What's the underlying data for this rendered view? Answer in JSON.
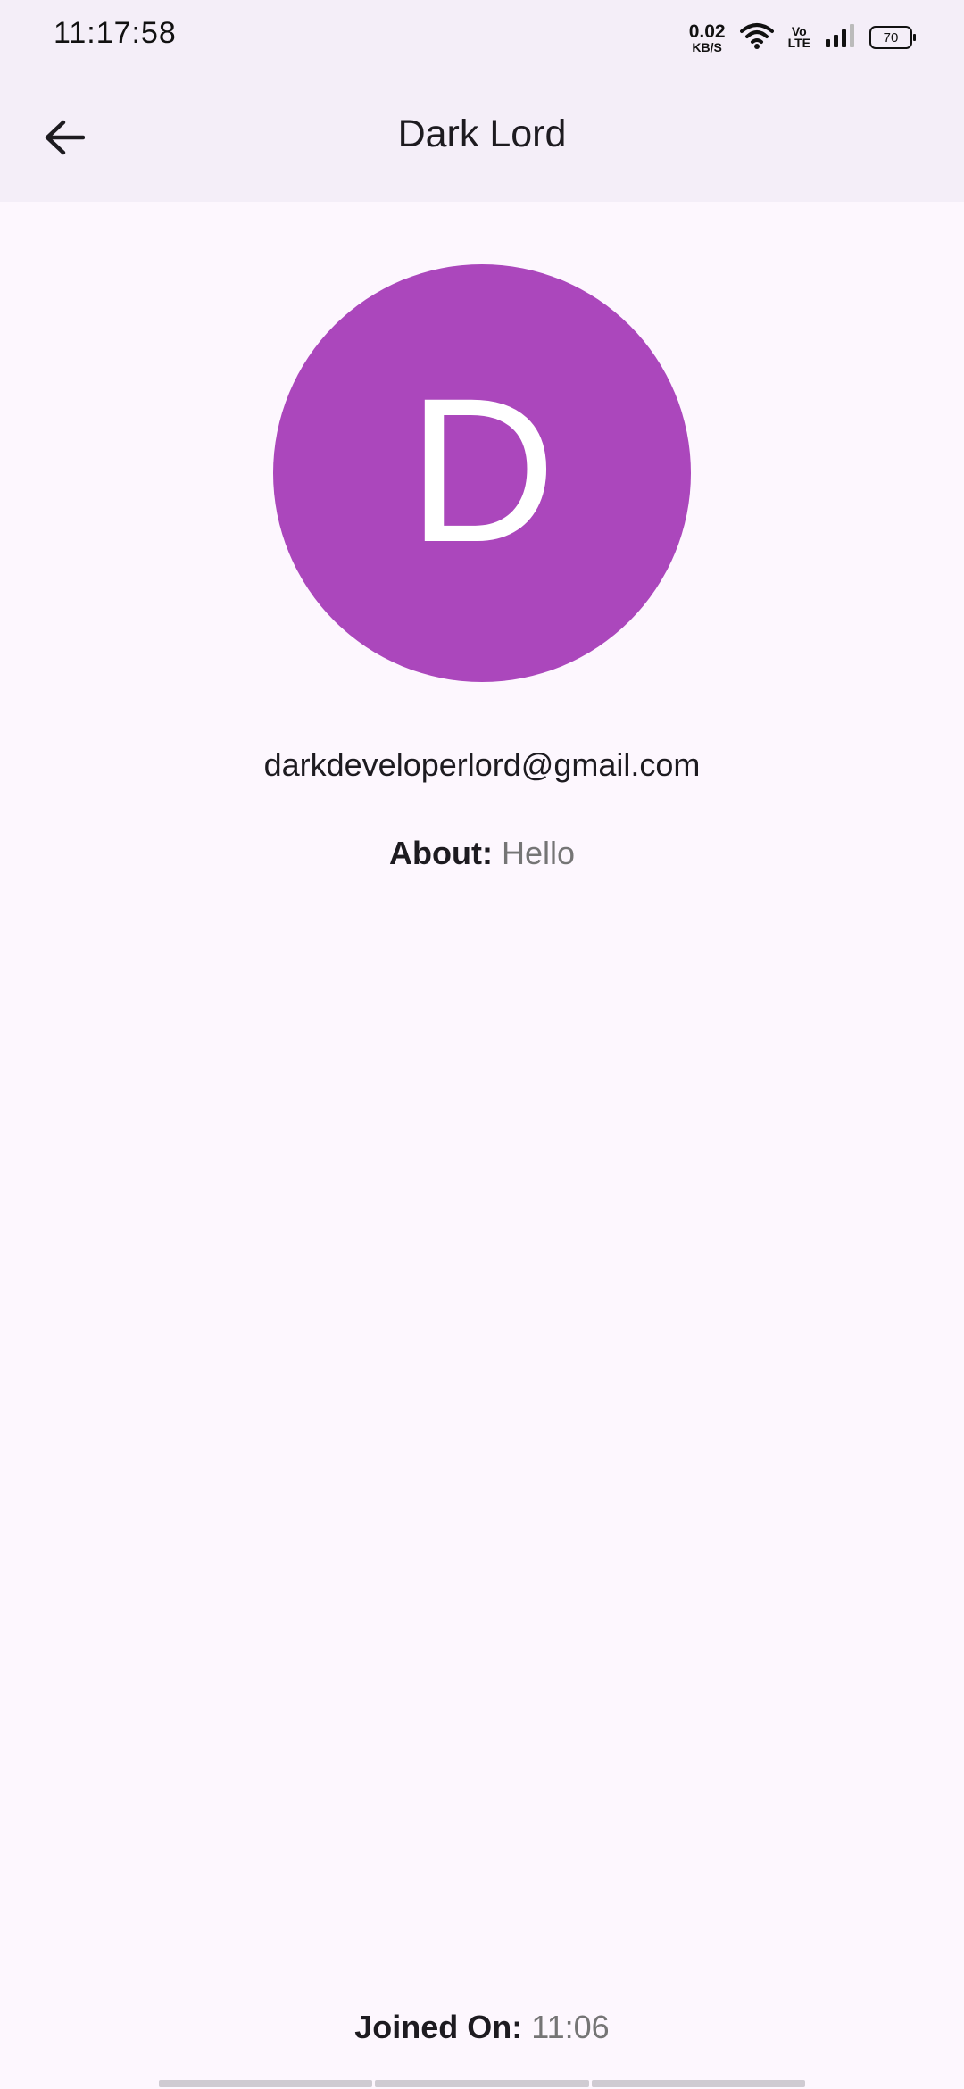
{
  "status_bar": {
    "time": "11:17:58",
    "net_speed_value": "0.02",
    "net_speed_unit": "KB/S",
    "volte_top": "Vo",
    "volte_bottom": "LTE",
    "battery": "70",
    "icons": [
      "wifi-icon",
      "volte-icon",
      "signal-icon",
      "battery-icon"
    ]
  },
  "app_bar": {
    "title": "Dark Lord",
    "back_icon": "arrow-back-icon"
  },
  "profile": {
    "avatar_letter": "D",
    "avatar_color": "#ab47bc",
    "email": "darkdeveloperlord@gmail.com",
    "about_label": "About: ",
    "about_value": "Hello",
    "joined_label": "Joined On: ",
    "joined_value": "11:06"
  },
  "colors": {
    "background": "#fdf7fe",
    "app_bar": "#f4eef8",
    "muted_text": "#757575"
  }
}
